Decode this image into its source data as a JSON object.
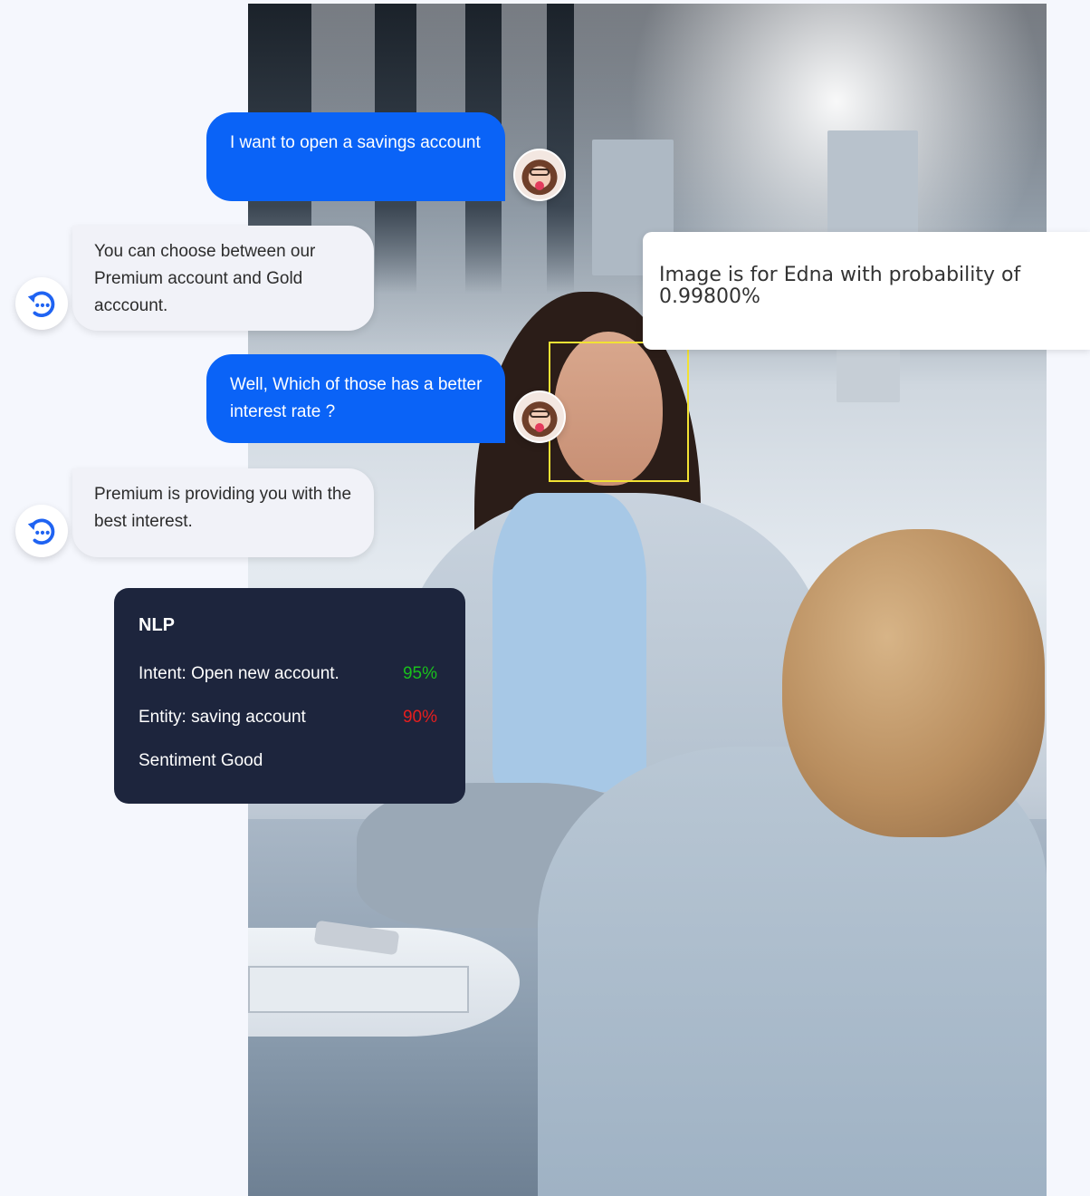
{
  "chat": {
    "messages": [
      {
        "role": "user",
        "text": "I want to open a savings account"
      },
      {
        "role": "bot",
        "text": "You can choose between our Premium account and Gold acccount."
      },
      {
        "role": "user",
        "text": "Well, Which of those has a better interest rate ?"
      },
      {
        "role": "bot",
        "text": "Premium is providing you with the best interest."
      }
    ]
  },
  "recognition": {
    "caption": "Image is for Edna with probability of 0.99800%"
  },
  "nlp": {
    "title": "NLP",
    "intent_label": "Intent: Open new account.",
    "intent_value": "95%",
    "entity_label": "Entity: saving account",
    "entity_value": "90%",
    "sentiment_label": "Sentiment Good"
  },
  "colors": {
    "user_bubble": "#0a63f7",
    "bot_bubble": "#f1f2f8",
    "nlp_card": "#1d253d",
    "intent_value": "#19c11c",
    "entity_value": "#e61e1e",
    "face_box": "#f2e234"
  },
  "icons": {
    "bot": "chat-bot-icon",
    "user": "user-avatar"
  }
}
